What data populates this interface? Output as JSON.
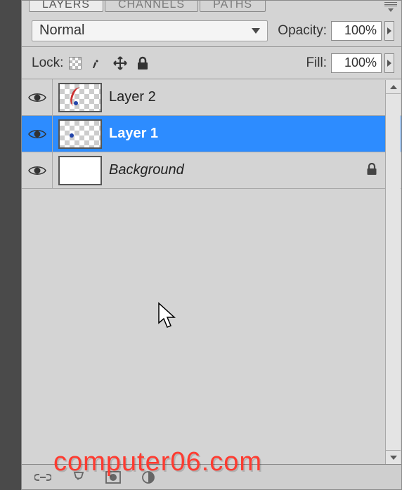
{
  "tabs": {
    "layers": "LAYERS",
    "channels": "CHANNELS",
    "paths": "PATHS"
  },
  "blend": {
    "mode": "Normal"
  },
  "opacity": {
    "label": "Opacity:",
    "value": "100%"
  },
  "lock": {
    "label": "Lock:"
  },
  "fill": {
    "label": "Fill:",
    "value": "100%"
  },
  "layers": [
    {
      "name": "Layer 2",
      "locked": false,
      "selected": false,
      "bg": false,
      "checker": true
    },
    {
      "name": "Layer 1",
      "locked": false,
      "selected": true,
      "bg": false,
      "checker": true
    },
    {
      "name": "Background",
      "locked": true,
      "selected": false,
      "bg": true,
      "checker": false
    }
  ],
  "watermark": "computer06.com"
}
